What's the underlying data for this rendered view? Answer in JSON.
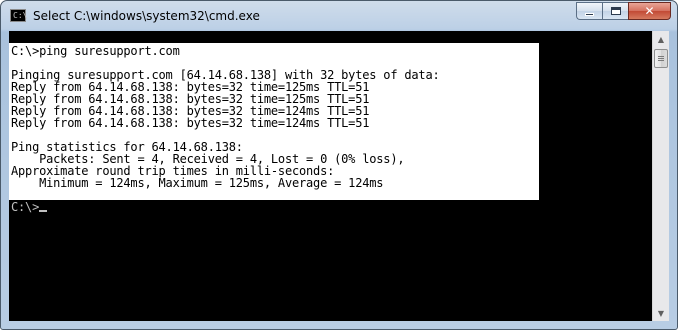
{
  "window": {
    "title": "Select C:\\windows\\system32\\cmd.exe",
    "icon_text": "C:\\"
  },
  "caption_buttons": {
    "minimize": "minimize-icon",
    "maximize": "maximize-icon",
    "close": "✕"
  },
  "console": {
    "selected_lines": [
      "C:\\>ping suresupport.com",
      "",
      "Pinging suresupport.com [64.14.68.138] with 32 bytes of data:",
      "Reply from 64.14.68.138: bytes=32 time=125ms TTL=51",
      "Reply from 64.14.68.138: bytes=32 time=125ms TTL=51",
      "Reply from 64.14.68.138: bytes=32 time=124ms TTL=51",
      "Reply from 64.14.68.138: bytes=32 time=124ms TTL=51",
      "",
      "Ping statistics for 64.14.68.138:",
      "    Packets: Sent = 4, Received = 4, Lost = 0 (0% loss),",
      "Approximate round trip times in milli-seconds:",
      "    Minimum = 124ms, Maximum = 125ms, Average = 124ms"
    ],
    "prompt": "C:\\>"
  },
  "scrollbar": {
    "up_arrow": "▲",
    "down_arrow": "▼"
  }
}
